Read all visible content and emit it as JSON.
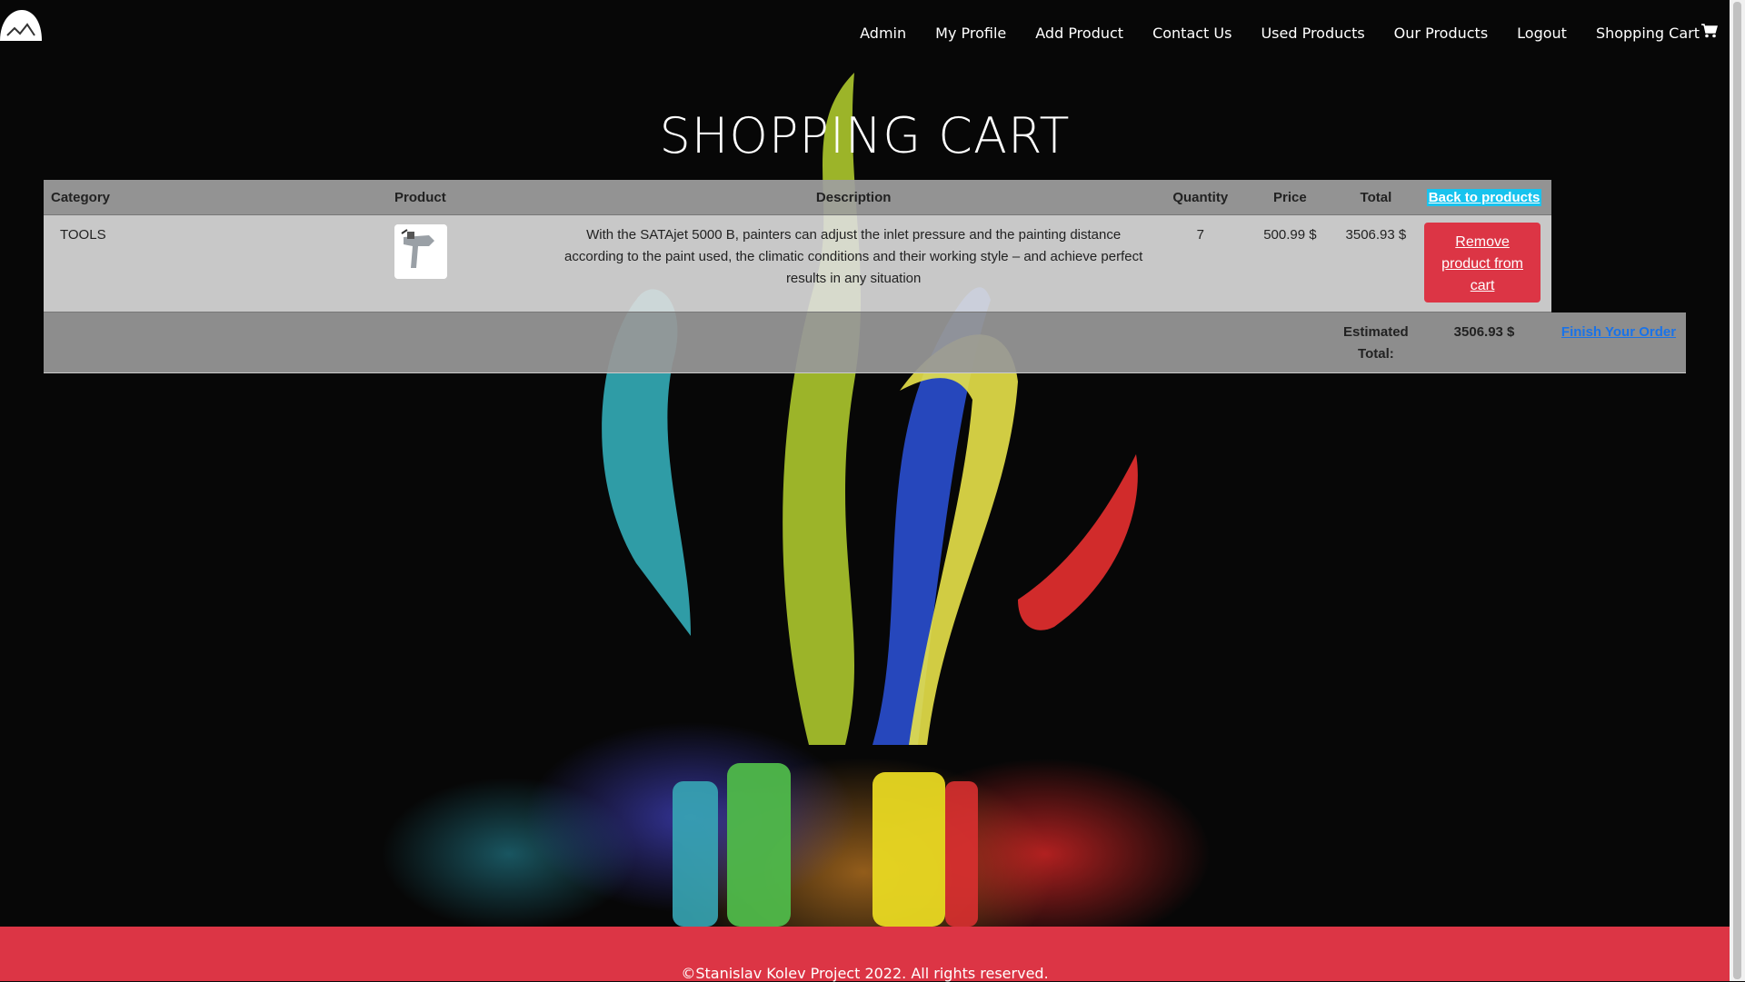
{
  "nav": {
    "items": [
      "Admin",
      "My Profile",
      "Add Product",
      "Contact Us",
      "Used Products",
      "Our Products",
      "Logout",
      "Shopping Cart"
    ]
  },
  "page_title": "SHOPPING CART",
  "table": {
    "headers": {
      "category": "Category",
      "product": "Product",
      "description": "Description",
      "quantity": "Quantity",
      "price": "Price",
      "total": "Total",
      "back_link": "Back to products"
    },
    "rows": [
      {
        "category": "TOOLS",
        "description": "With the SATAjet 5000 B, painters can adjust the inlet pressure and the painting distance according to the paint used, the climatic conditions and their working style – and achieve perfect results in any situation",
        "quantity": "7",
        "price": "500.99 $",
        "total": "3506.93 $",
        "remove_label": "Remove product from cart"
      }
    ],
    "summary": {
      "label": "Estimated Total:",
      "value": "3506.93 $",
      "finish_label": "Finish Your Order"
    }
  },
  "footer": {
    "text": "©Stanislav Kolev Project 2022. All rights reserved."
  },
  "colors": {
    "footer_bg": "#dc3545",
    "remove_button": "#dc3545",
    "back_link_bg": "#18c3ee",
    "finish_link": "#1a73e8"
  },
  "icons": {
    "logo": "paint-splash-logo",
    "cart": "shopping-cart-icon"
  }
}
